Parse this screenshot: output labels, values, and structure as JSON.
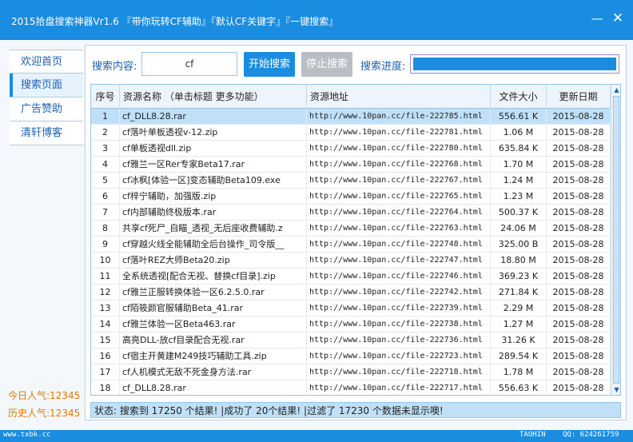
{
  "window": {
    "title": "2015拾盘搜索神器Vr1.6 『带你玩转CF辅助』『默认CF关键字』『一键搜索』",
    "minimize_glyph": "—",
    "close_glyph": "✕"
  },
  "sidebar": {
    "items": [
      {
        "label": "欢迎首页"
      },
      {
        "label": "搜索页面"
      },
      {
        "label": "广告赞助"
      },
      {
        "label": "清轩博客"
      }
    ],
    "today_views": "今日人气:12345",
    "history_views": "历史人气:12345"
  },
  "search": {
    "content_label": "搜索内容:",
    "keyword": "cf",
    "start_button": "开始搜索",
    "stop_button": "停止搜索",
    "progress_label": "搜索进度:",
    "progress_fraction": 1.0
  },
  "table": {
    "columns": [
      "序号",
      "资源名称 （单击标题 更多功能）",
      "资源地址",
      "文件大小",
      "更新日期"
    ],
    "selected_index": 0,
    "rows": [
      [
        "1",
        "cf_DLL8.28.rar",
        "http://www.10pan.cc/file-222785.html",
        "556.61 K",
        "2015-08-28"
      ],
      [
        "2",
        "cf落叶单板透视v-12.zip",
        "http://www.10pan.cc/file-222781.html",
        "1.06 M",
        "2015-08-28"
      ],
      [
        "3",
        "cf单板透视dll.zip",
        "http://www.10pan.cc/file-222780.html",
        "635.84 K",
        "2015-08-28"
      ],
      [
        "4",
        "cf雅兰一区Rer专家Beta17.rar",
        "http://www.10pan.cc/file-222768.html",
        "1.70 M",
        "2015-08-28"
      ],
      [
        "5",
        "cf冰枫[体验一区]变态辅助Beta109.exe",
        "http://www.10pan.cc/file-222767.html",
        "1.24 M",
        "2015-08-28"
      ],
      [
        "6",
        "cf梓宁辅助，加强版.zip",
        "http://www.10pan.cc/file-222765.html",
        "1.23 M",
        "2015-08-28"
      ],
      [
        "7",
        "cf内部辅助终极版本.rar",
        "http://www.10pan.cc/file-222764.html",
        "500.37 K",
        "2015-08-28"
      ],
      [
        "8",
        "共享cf死尸_自瞄_透视_无后座收费辅助.z",
        "http://www.10pan.cc/file-222763.html",
        "24.06 M",
        "2015-08-28"
      ],
      [
        "9",
        "cf穿越火线全能辅助全后台操作_司令版__",
        "http://www.10pan.cc/file-222748.html",
        "325.00 B",
        "2015-08-28"
      ],
      [
        "10",
        "cf落叶REZ大师Beta20.zip",
        "http://www.10pan.cc/file-222747.html",
        "18.80 M",
        "2015-08-28"
      ],
      [
        "11",
        "全系统透视[配合无视、替换cf目录].zip",
        "http://www.10pan.cc/file-222746.html",
        "369.23 K",
        "2015-08-28"
      ],
      [
        "12",
        "cf雅兰正服转换体验一区6.2.5.0.rar",
        "http://www.10pan.cc/file-222742.html",
        "271.84 K",
        "2015-08-28"
      ],
      [
        "13",
        "cf陌筱颜官服辅助Beta_41.rar",
        "http://www.10pan.cc/file-222739.html",
        "2.29 M",
        "2015-08-28"
      ],
      [
        "14",
        "cf雅兰体验一区Beta463.rar",
        "http://www.10pan.cc/file-222738.html",
        "1.27 M",
        "2015-08-28"
      ],
      [
        "15",
        "高亮DLL-放cf目录配合无视.rar",
        "http://www.10pan.cc/file-222736.html",
        "31.26 K",
        "2015-08-28"
      ],
      [
        "16",
        "cf宿主开黄建M249技巧辅助工具.zip",
        "http://www.10pan.cc/file-222723.html",
        "289.54 K",
        "2015-08-28"
      ],
      [
        "17",
        "cf人机模式无敌不死金身方法.rar",
        "http://www.10pan.cc/file-222718.html",
        "1.78 M",
        "2015-08-28"
      ],
      [
        "18",
        "cf_DLL8.28.rar",
        "http://www.10pan.cc/file-222717.html",
        "556.63 K",
        "2015-08-28"
      ]
    ]
  },
  "status": {
    "text": "状态: 搜索到  17250  个结果!   |成功了  20个结果!   |过滤了 17230 个数据未显示噢!"
  },
  "footer": {
    "left": "www.txbk.cc",
    "middle": "TAOHIN",
    "right": "QQ: 624261759"
  }
}
